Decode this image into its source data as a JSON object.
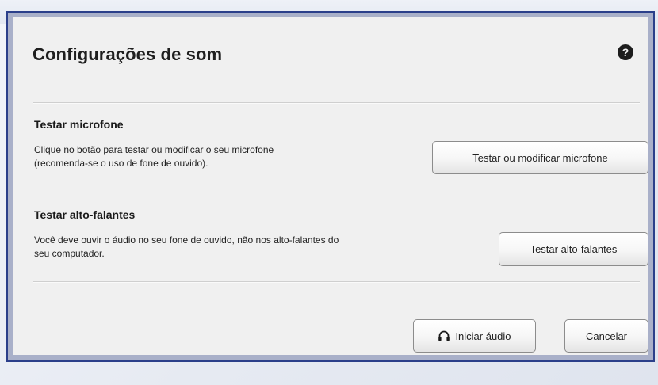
{
  "dialog": {
    "title": "Configurações de som",
    "help_icon": "question-circle-icon",
    "help_glyph": "?"
  },
  "microphone": {
    "heading": "Testar microfone",
    "description_line1": "Clique no botão para testar ou modificar o seu microfone",
    "description_line2": "(recomenda-se o uso de fone de ouvido).",
    "button_label": "Testar ou modificar microfone"
  },
  "speakers": {
    "heading": "Testar alto-falantes",
    "description_line1": "Você deve ouvir o áudio no seu fone de ouvido, não nos alto-falantes do",
    "description_line2": "seu computador.",
    "button_label": "Testar alto-falantes"
  },
  "footer": {
    "start_audio_label": "Iniciar áudio",
    "start_audio_icon": "headset-icon",
    "cancel_label": "Cancelar"
  },
  "colors": {
    "frame_border": "#2b3f8a",
    "dialog_background": "#f0f0f0",
    "text": "#1f1f1f"
  }
}
